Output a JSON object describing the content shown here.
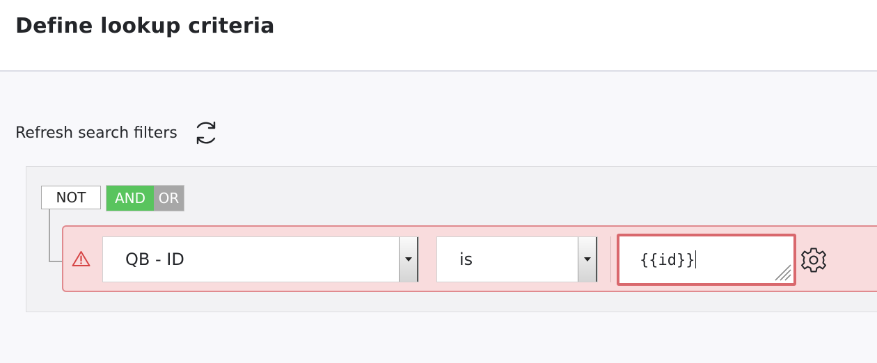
{
  "header": {
    "title": "Define lookup criteria"
  },
  "toolbar": {
    "refresh_label": "Refresh search filters",
    "refresh_icon": "refresh-icon"
  },
  "logic": {
    "not_label": "NOT",
    "and_label": "AND",
    "or_label": "OR",
    "active": "AND",
    "active_color": "#59c45e",
    "inactive_color": "#a7a7a7"
  },
  "rule": {
    "status_icon": "warning-icon",
    "status_color": "#d9686d",
    "field": "QB - ID",
    "operator": "is",
    "value": "{{id}}",
    "settings_icon": "gear-icon"
  }
}
